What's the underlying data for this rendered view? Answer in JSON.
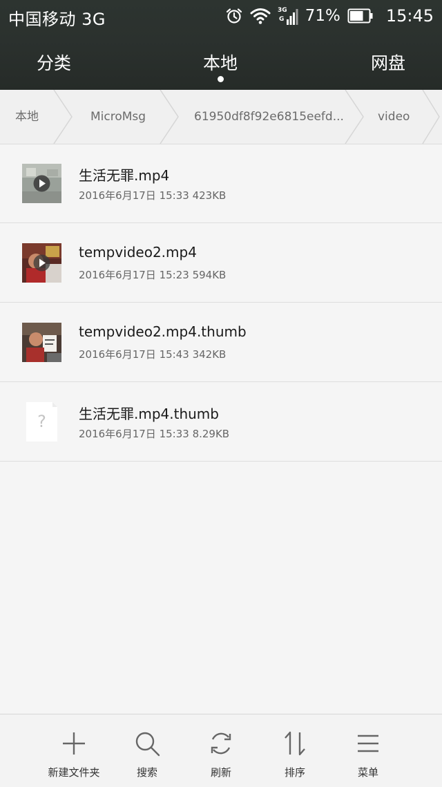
{
  "status_bar": {
    "carrier": "中国移动 3G",
    "network_badge_top": "3G",
    "network_badge_bottom": "G",
    "battery_percent": "71%",
    "battery_level": 0.71,
    "time": "15:45"
  },
  "tabs": [
    {
      "label": "分类"
    },
    {
      "label": "本地"
    },
    {
      "label": "网盘"
    }
  ],
  "active_tab": "本地",
  "breadcrumb": [
    {
      "label": "本地"
    },
    {
      "label": "MicroMsg"
    },
    {
      "label": "61950df8f92e6815eefd..."
    },
    {
      "label": "video"
    }
  ],
  "files": [
    {
      "name": "生活无罪.mp4",
      "meta": "2016年6月17日 15:33 423KB",
      "thumb": "video-thumbnail-icon"
    },
    {
      "name": "tempvideo2.mp4",
      "meta": "2016年6月17日 15:23 594KB",
      "thumb": "video-thumbnail-icon"
    },
    {
      "name": "tempvideo2.mp4.thumb",
      "meta": "2016年6月17日 15:43 342KB",
      "thumb": "image-thumbnail-icon"
    },
    {
      "name": "生活无罪.mp4.thumb",
      "meta": "2016年6月17日 15:33 8.29KB",
      "thumb": "unknown-file-icon"
    }
  ],
  "toolbar": {
    "new_folder": "新建文件夹",
    "search": "搜索",
    "refresh": "刷新",
    "sort": "排序",
    "menu": "菜单"
  },
  "colors": {
    "header_bg": "#2b312e",
    "page_bg": "#f5f5f5",
    "breadcrumb_bg": "#f0f0f0",
    "toolbar_bg": "#f3f3f3",
    "icon_gray": "#666666"
  }
}
